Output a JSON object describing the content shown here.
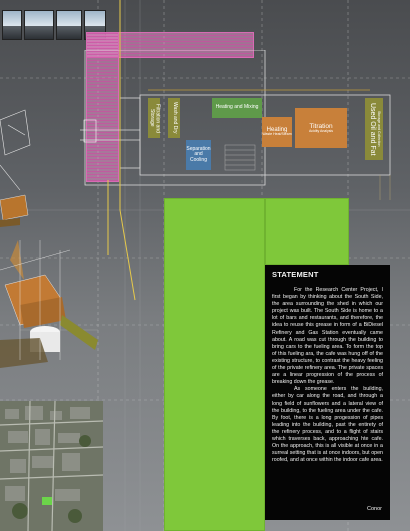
{
  "rooms": {
    "heating_mixing": "Heating and Mixing",
    "heating": "Heating",
    "heating_sub": "Waste Heat/Steam",
    "titration": "Titration",
    "titration_sub": "Acidity Analysis",
    "separation": "Separation and Cooling",
    "wash_dry": "Wash and Dry",
    "filtration": "Filtration and Storage",
    "used_oil": "Used Oil and Fat",
    "used_oil_sub": "Storage and Collection"
  },
  "statement": {
    "heading": "STATEMENT",
    "paragraph1": "For the Research Center Project, I first began by thinking about the South Side, the area surrounding the shed in which our project was built. The South Side is home to a lot of bars and restaurants, and therefore, the idea to reuse this grease in form of a BiDiesel Refinery and Gas Station eventually came about. A road was cut through the building to bring cars to the fueling area. To form the top of this fueling ara, the cafe was hung off of the existing structure, to contrast the heavy feeling of the private refinery area. The private spaces are a linear progression of the process of breaking down the grease.",
    "paragraph2": "As someone enters the building, either by car along the road, and through a long field of sunflowers and a lateral view of the building, to the fueling area under the cafe. By foot, there is a long progession of pipes leading into the building, past the entirety of the refinery process, and to a flight of stairs which traverses back, approaching hte cafe. On the approach, this is all visible at once in a surreal setting that is at once indoors, but open roofed, and at once within the indoor cafe area.",
    "signature": "Conor"
  },
  "colors": {
    "pink": "#d76cb3",
    "green_field": "#7fc83a",
    "olive": "#8a8a3a",
    "orange": "#c8803a",
    "blue_room": "#4a7aa8",
    "statement_bg": "#050505"
  }
}
